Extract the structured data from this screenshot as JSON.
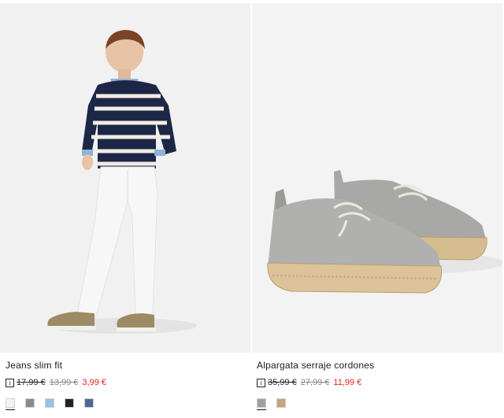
{
  "products": [
    {
      "title": "Jeans slim fit",
      "info_icon": "info-icon",
      "price_original": "17,99 €",
      "price_previous": "13,99 €",
      "price_sale": "3,99 €",
      "swatch_colors": [
        "#f4f4f4",
        "#8c8c8c",
        "#9cc1df",
        "#222222",
        "#4a6a92"
      ]
    },
    {
      "title": "Alpargata serraje cordones",
      "info_icon": "info-icon",
      "price_original": "35,99 €",
      "price_previous": "27,99 €",
      "price_sale": "11,99 €",
      "swatch_colors": [
        "#9f9f9b",
        "#c9a27f"
      ]
    }
  ],
  "colors": {
    "sale": "#e2231a",
    "photo_background": "#f1f1f1"
  }
}
